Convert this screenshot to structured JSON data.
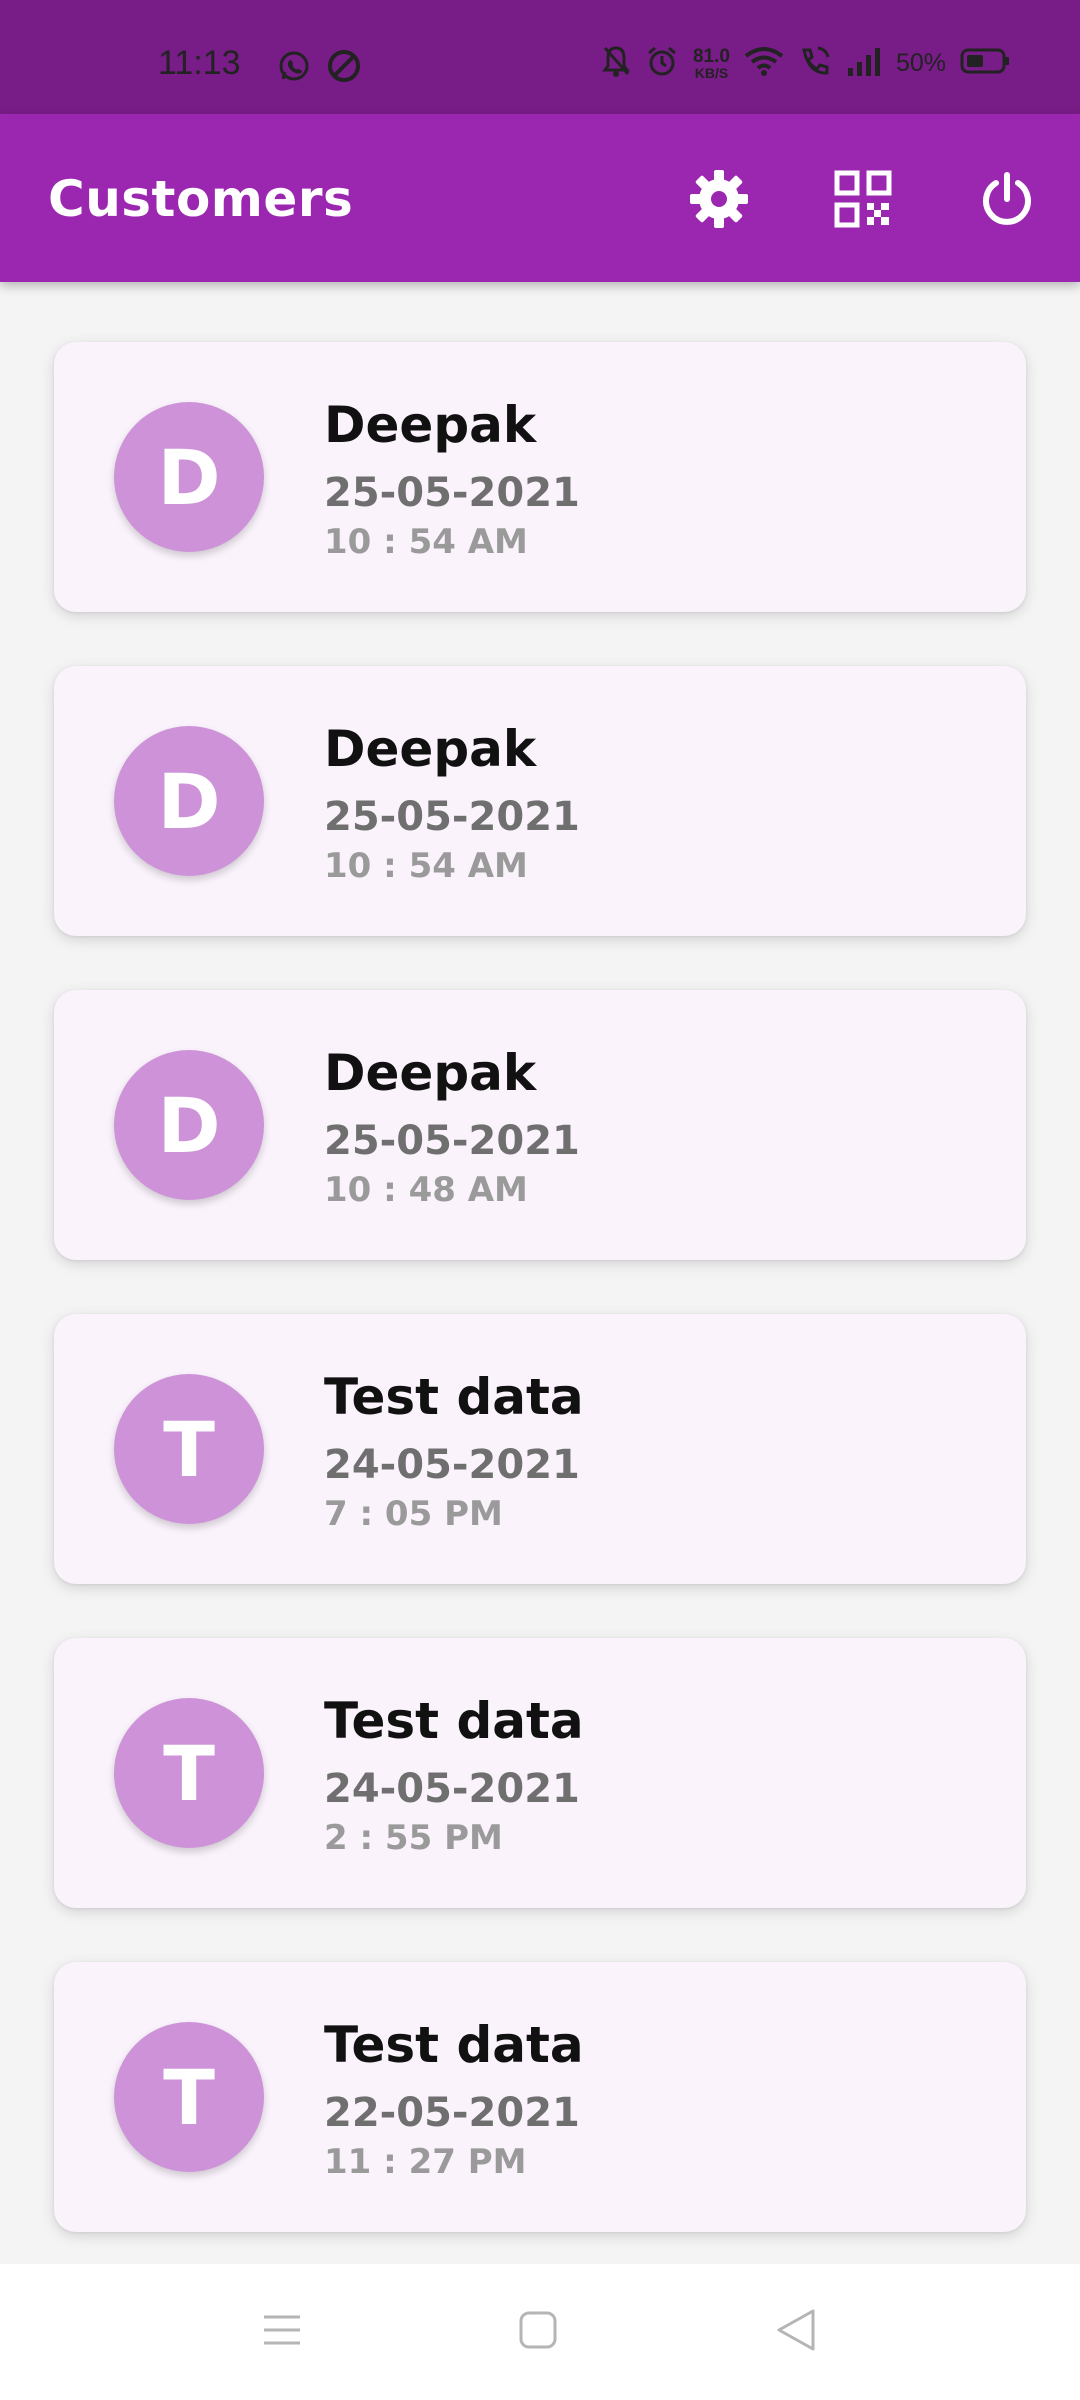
{
  "status_bar": {
    "time": "11:13",
    "net_speed_value": "81.0",
    "net_speed_unit": "KB/S",
    "battery_text": "50%"
  },
  "app_bar": {
    "title": "Customers",
    "actions": [
      "gear-icon",
      "qr-code-icon",
      "power-icon"
    ]
  },
  "customers": [
    {
      "initial": "D",
      "name": "Deepak",
      "date": "25-05-2021",
      "time": "10 : 54 AM"
    },
    {
      "initial": "D",
      "name": "Deepak",
      "date": "25-05-2021",
      "time": "10 : 54 AM"
    },
    {
      "initial": "D",
      "name": "Deepak",
      "date": "25-05-2021",
      "time": "10 : 48 AM"
    },
    {
      "initial": "T",
      "name": "Test data",
      "date": "24-05-2021",
      "time": "7 : 05 PM"
    },
    {
      "initial": "T",
      "name": "Test data",
      "date": "24-05-2021",
      "time": "2 : 55 PM"
    },
    {
      "initial": "T",
      "name": "Test data",
      "date": "22-05-2021",
      "time": "11 : 27 PM"
    }
  ],
  "nav_bar": {
    "buttons": [
      "menu-icon",
      "home-square-icon",
      "back-triangle-icon"
    ]
  },
  "colors": {
    "status_bar": "#781c87",
    "app_bar": "#9b27b0",
    "card_bg": "#fbf3fc",
    "avatar_bg": "#cd92d8"
  }
}
